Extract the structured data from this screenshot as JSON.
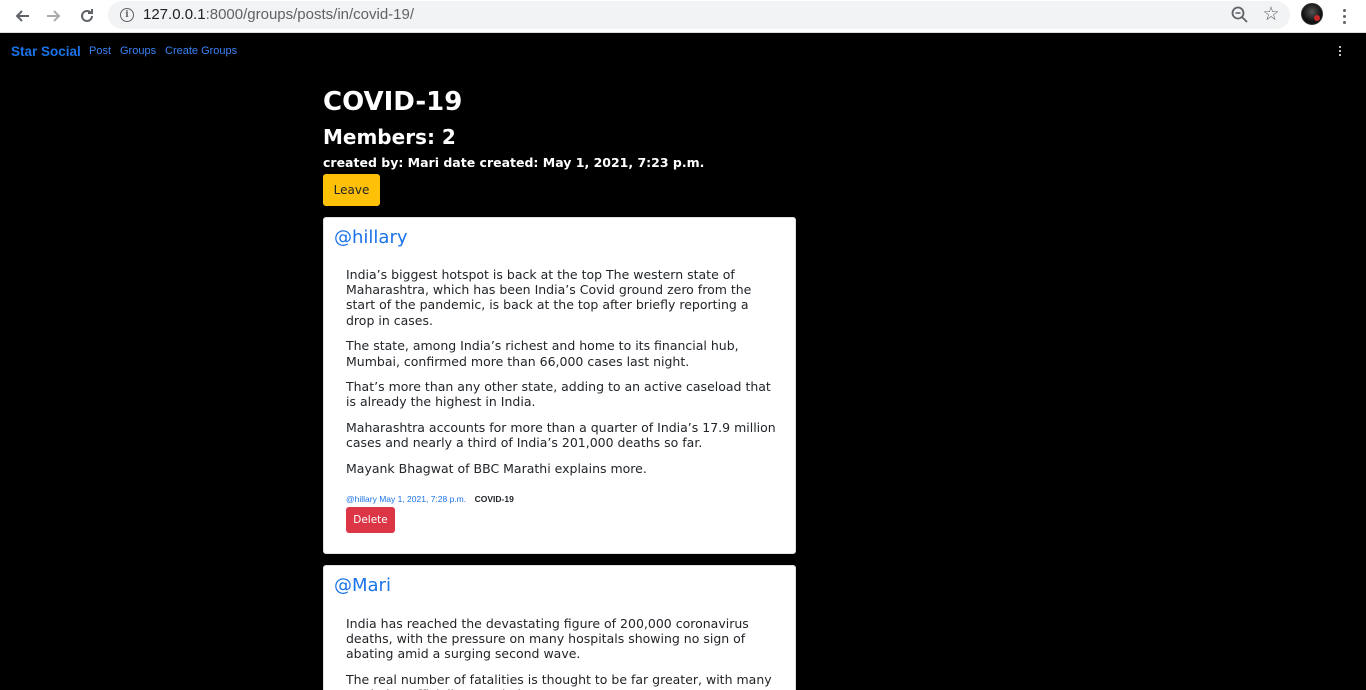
{
  "browser": {
    "url_host": "127.0.0.1",
    "url_rest": ":8000/groups/posts/in/covid-19/"
  },
  "navbar": {
    "brand": "Star Social",
    "links": [
      "Post",
      "Groups",
      "Create Groups"
    ]
  },
  "group": {
    "title": "COVID-19",
    "members": "Members: 2",
    "meta": "created by: Mari date created: May 1, 2021, 7:23 p.m.",
    "leave_label": "Leave"
  },
  "posts": [
    {
      "author": "@hillary",
      "paragraphs": [
        "India’s biggest hotspot is back at the top The western state of Maharashtra, which has been India’s Covid ground zero from the start of the pandemic, is back at the top after briefly reporting a drop in cases.",
        "The state, among India’s richest and home to its financial hub, Mumbai, confirmed more than 66,000 cases last night.",
        "That’s more than any other state, adding to an active caseload that is already the highest in India.",
        "Maharashtra accounts for more than a quarter of India’s 17.9 million cases and nearly a third of India’s 201,000 deaths so far.",
        "Mayank Bhagwat of BBC Marathi explains more."
      ],
      "meta_author": "@hillary May 1, 2021, 7:28 p.m.",
      "meta_group": "COVID-19",
      "delete_label": "Delete"
    },
    {
      "author": "@Mari",
      "paragraphs": [
        "India has reached the devastating figure of 200,000 coronavirus deaths, with the pressure on many hospitals showing no sign of abating amid a surging second wave.",
        "The real number of fatalities is thought to be far greater, with many not being officially recorded."
      ]
    }
  ]
}
